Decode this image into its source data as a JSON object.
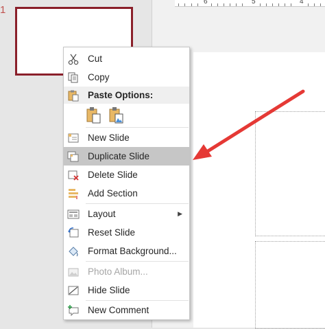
{
  "thumbnail": {
    "slide_number": "1"
  },
  "ruler": {
    "labels": [
      "6",
      "5",
      "4"
    ]
  },
  "context_menu": {
    "items": {
      "cut": "Cut",
      "copy": "Copy",
      "paste_options": "Paste Options:",
      "new_slide": "New Slide",
      "duplicate_slide": "Duplicate Slide",
      "delete_slide": "Delete Slide",
      "add_section": "Add Section",
      "layout": "Layout",
      "reset_slide": "Reset Slide",
      "format_background": "Format Background...",
      "photo_album": "Photo Album...",
      "hide_slide": "Hide Slide",
      "new_comment": "New Comment"
    },
    "highlighted_item": "Duplicate Slide",
    "disabled_items": [
      "Photo Album..."
    ]
  },
  "colors": {
    "thumbnail_border": "#8a1f2a",
    "annotation_arrow": "#e53935",
    "highlight": "#c6c6c6"
  }
}
